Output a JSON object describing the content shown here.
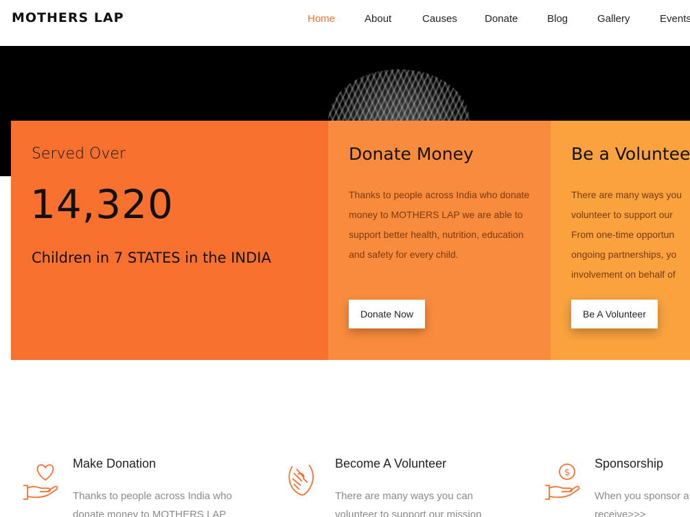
{
  "header": {
    "logo": "MOTHERS LAP",
    "nav": [
      "Home",
      "About",
      "Causes",
      "Donate",
      "Blog",
      "Gallery",
      "Events"
    ],
    "active": "Home"
  },
  "colors": {
    "accent": "#f86f2d",
    "box1": "#f7702e",
    "box2": "#f98c3c",
    "box3": "#f9a23e"
  },
  "stats": {
    "label": "Served Over",
    "number": "14,320",
    "sub": "Children in 7 STATES in the INDIA"
  },
  "donate_box": {
    "title": "Donate Money",
    "text": "Thanks to people across India who donate money to MOTHERS LAP we are able to support better health, nutrition, education and safety for every child.",
    "button": "Donate Now"
  },
  "volunteer_box": {
    "title": "Be a Volunteer",
    "lines": [
      "There are many ways you",
      "volunteer to support our",
      "From one-time opportun",
      "ongoing partnerships, yo",
      "involvement on behalf of"
    ],
    "button": "Be A Volunteer"
  },
  "features": [
    {
      "icon": "heart-hand-icon",
      "title": "Make Donation",
      "lines": [
        "Thanks to people across India who",
        "donate money to MOTHERS LAP"
      ]
    },
    {
      "icon": "volunteer-hand-icon",
      "title": "Become A Volunteer",
      "lines": [
        "There are many ways you can",
        "volunteer to support our mission"
      ]
    },
    {
      "icon": "dollar-hand-icon",
      "title": "Sponsorship",
      "lines": [
        "When you sponsor a",
        "receive>>>"
      ]
    }
  ]
}
